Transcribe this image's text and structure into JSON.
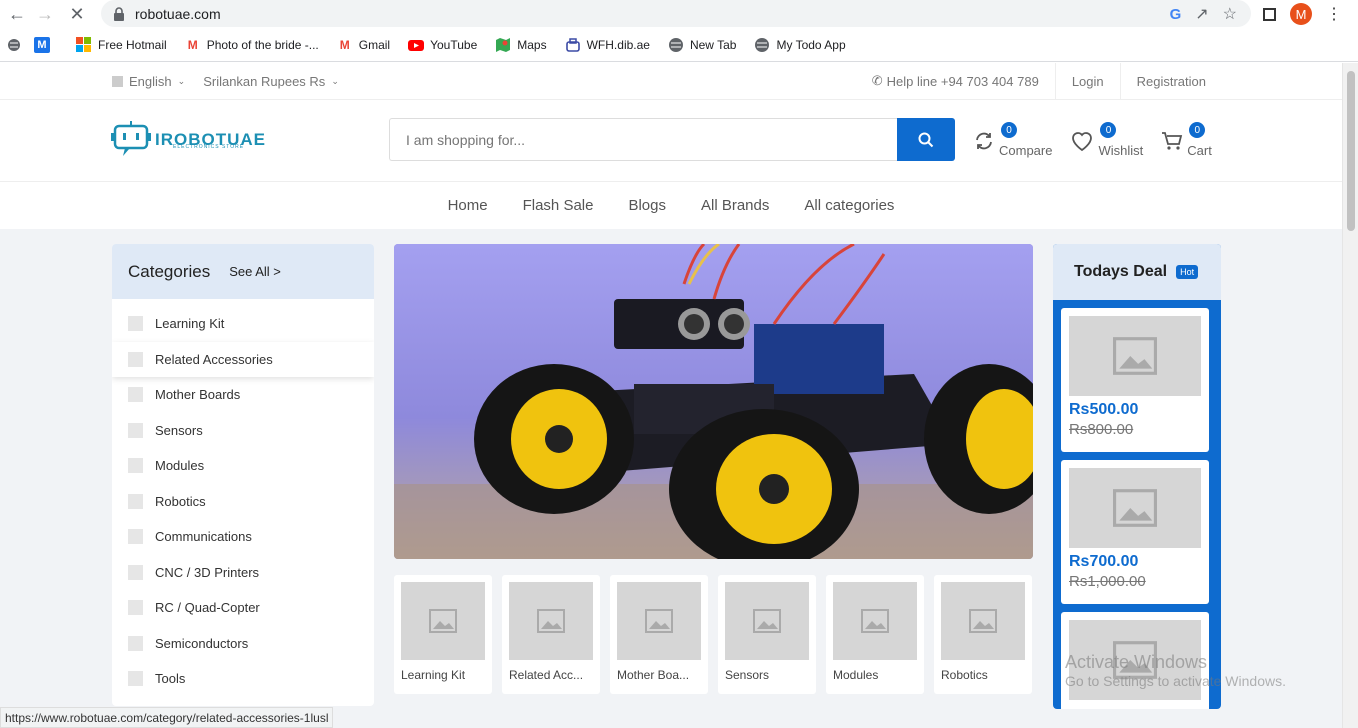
{
  "browser": {
    "url": "robotuae.com",
    "avatar_letter": "M",
    "bookmarks": [
      {
        "label": "Free Hotmail",
        "icon": "windows-icon"
      },
      {
        "label": "Photo of the bride -...",
        "icon": "gmail-icon"
      },
      {
        "label": "Gmail",
        "icon": "gmail-icon"
      },
      {
        "label": "YouTube",
        "icon": "youtube-icon"
      },
      {
        "label": "Maps",
        "icon": "maps-icon"
      },
      {
        "label": "WFH.dib.ae",
        "icon": "wfh-icon"
      },
      {
        "label": "New Tab",
        "icon": "globe-icon"
      },
      {
        "label": "My Todo App",
        "icon": "globe-icon"
      }
    ],
    "status_url": "https://www.robotuae.com/category/related-accessories-1lusl"
  },
  "topbar": {
    "language": "English",
    "currency": "Srilankan Rupees Rs",
    "helpline": "Help line +94 703 404 789",
    "login": "Login",
    "registration": "Registration"
  },
  "header": {
    "logo_text": "IROBOTUAE",
    "logo_sub": "ELECTRONICS STORE",
    "search_placeholder": "I am shopping for...",
    "compare_label": "Compare",
    "compare_count": "0",
    "wishlist_label": "Wishlist",
    "wishlist_count": "0",
    "cart_label": "Cart",
    "cart_count": "0"
  },
  "mainnav": [
    "Home",
    "Flash Sale",
    "Blogs",
    "All Brands",
    "All categories"
  ],
  "categories": {
    "title": "Categories",
    "see_all": "See All >",
    "items": [
      "Learning Kit",
      "Related Accessories",
      "Mother Boards",
      "Sensors",
      "Modules",
      "Robotics",
      "Communications",
      "CNC / 3D Printers",
      "RC / Quad-Copter",
      "Semiconductors",
      "Tools"
    ]
  },
  "thumbs": [
    "Learning Kit",
    "Related Acc...",
    "Mother Boa...",
    "Sensors",
    "Modules",
    "Robotics"
  ],
  "deal": {
    "title": "Todays Deal",
    "badge": "Hot",
    "items": [
      {
        "price": "Rs500.00",
        "old_price": "Rs800.00"
      },
      {
        "price": "Rs700.00",
        "old_price": "Rs1,000.00"
      }
    ]
  },
  "watermark": {
    "line1": "Activate Windows",
    "line2": "Go to Settings to activate Windows."
  },
  "colors": {
    "accent": "#0e6bcf",
    "panel_head": "#dfe9f6",
    "page_bg": "#f1f3f6"
  }
}
